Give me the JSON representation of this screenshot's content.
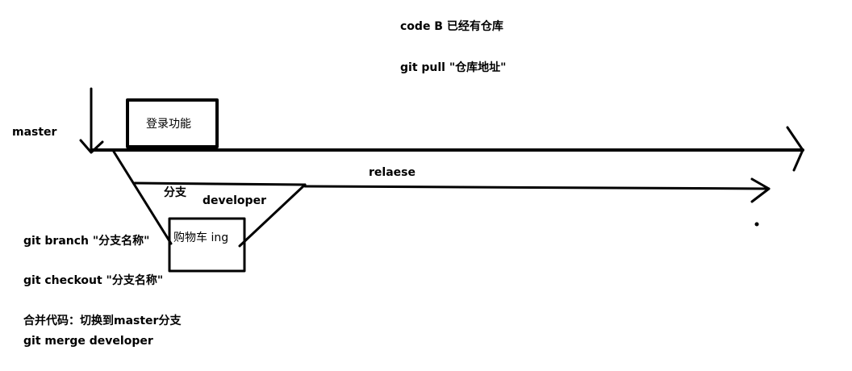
{
  "header": {
    "line1": "code B  已经有仓库",
    "line2": "git pull \"仓库地址\""
  },
  "diagram": {
    "master_label": "master",
    "login_box_label": "登录功能",
    "release_label": "relaese",
    "branch_label": "分支",
    "developer_label": "developer",
    "cart_box_label": "购物车 ing"
  },
  "commands": {
    "branch_cmd": "git branch \"分支名称\"",
    "checkout_cmd": "git checkout \"分支名称\"",
    "merge_note": "合并代码：切换到master分支",
    "merge_cmd": "git merge developer"
  },
  "colors": {
    "ink": "#000000",
    "background": "#ffffff"
  }
}
